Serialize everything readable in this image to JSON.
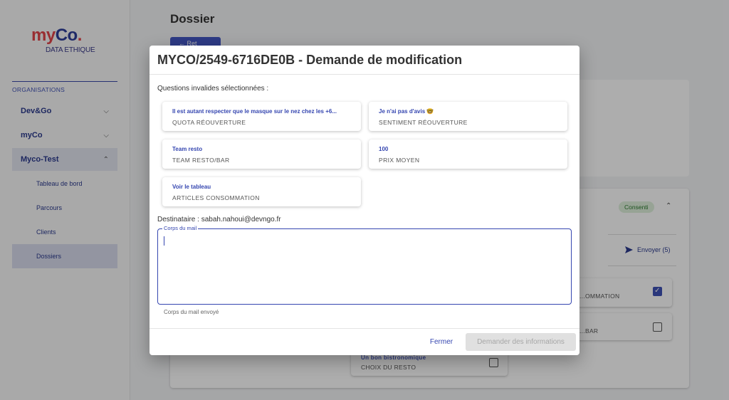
{
  "logo": {
    "my": "my",
    "co": "Co",
    "dot": ".",
    "subtitle": "DATA ETHIQUE"
  },
  "sidebar": {
    "section_label": "ORGANISATIONS",
    "orgs": [
      {
        "label": "Dev&Go",
        "chevron": "chevron-down-icon"
      },
      {
        "label": "myCo",
        "chevron": "chevron-down-icon"
      },
      {
        "label": "Myco-Test",
        "chevron": "chevron-up-icon"
      }
    ],
    "sub_items": [
      {
        "label": "Tableau de bord"
      },
      {
        "label": "Parcours"
      },
      {
        "label": "Clients"
      },
      {
        "label": "Dossiers",
        "active": true
      }
    ]
  },
  "page": {
    "title": "Dossier",
    "button_label": "← Ret"
  },
  "background": {
    "badge": "Consenti",
    "send_label": "Envoyer (5)",
    "options": [
      {
        "label": "...OMMATION",
        "checked": true
      },
      {
        "label": "...BAR",
        "checked": false
      },
      {
        "title": "Un bon bistronomique",
        "label": "CHOIX DU RESTO",
        "checked": false
      }
    ]
  },
  "dialog": {
    "title": "MYCO/2549-6716DE0B - Demande de modification",
    "questions_label": "Questions invalides sélectionnées :",
    "questions": [
      {
        "title": "Il est autant respecter que le masque sur le nez chez les +6...",
        "category": "QUOTA RÉOUVERTURE"
      },
      {
        "title": "Je n'ai pas d'avis 🤓",
        "category": "SENTIMENT RÉOUVERTURE"
      },
      {
        "title": "Team resto",
        "category": "TEAM RESTO/BAR"
      },
      {
        "title": "100",
        "category": "PRIX MOYEN"
      },
      {
        "title": "Voir le tableau",
        "category": "ARTICLES CONSOMMATION"
      }
    ],
    "recipient": "Destinataire : sabah.nahoui@devngo.fr",
    "mail_body": {
      "legend": "Corps du mail",
      "value": "",
      "helper": "Corps du mail envoyé"
    },
    "close_label": "Fermer",
    "request_label": "Demander des informations"
  },
  "colors": {
    "primary": "#3546b0",
    "logo_red": "#e2444a",
    "badge_green": "#2e7d32",
    "disabled_bg": "#e0e0e0"
  }
}
